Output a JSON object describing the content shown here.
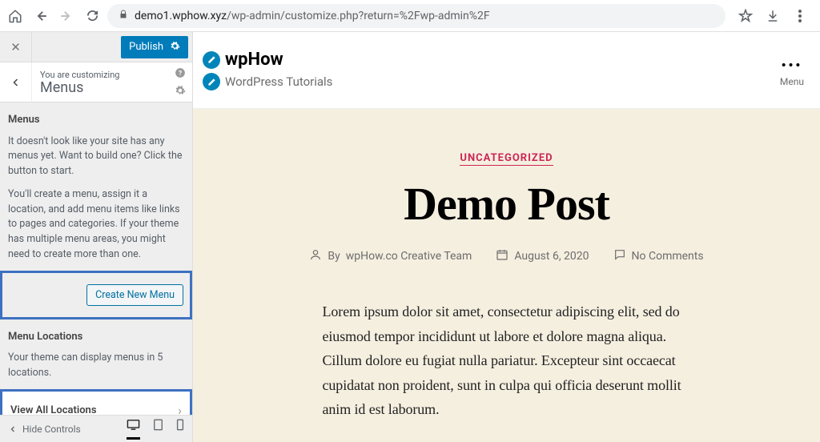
{
  "browser": {
    "url_domain": "demo1.wphow.xyz",
    "url_path": "/wp-admin/customize.php?return=%2Fwp-admin%2F"
  },
  "customizer": {
    "publish_label": "Publish",
    "customizing_label": "You are customizing",
    "panel_name": "Menus",
    "section_title": "Menus",
    "desc1": "It doesn't look like your site has any menus yet. Want to build one? Click the button to start.",
    "desc2": "You'll create a menu, assign it a location, and add menu items like links to pages and categories. If your theme has multiple menu areas, you might need to create more than one.",
    "create_btn": "Create New Menu",
    "locations_title": "Menu Locations",
    "locations_desc": "Your theme can display menus in 5 locations.",
    "view_all": "View All Locations",
    "hide_controls": "Hide Controls"
  },
  "preview": {
    "site_title": "wpHow",
    "site_tagline": "WordPress Tutorials",
    "menu_label": "Menu",
    "category": "UNCATEGORIZED",
    "post_title": "Demo Post",
    "by_label": "By",
    "author": "wpHow.co Creative Team",
    "date": "August 6, 2020",
    "comments": "No Comments",
    "content": "Lorem ipsum dolor sit amet, consectetur adipiscing elit, sed do eiusmod tempor incididunt ut labore et dolore magna aliqua. Cillum dolore eu fugiat nulla pariatur. Excepteur sint occaecat cupidatat non proident, sunt in culpa qui officia deserunt mollit anim id est laborum."
  }
}
